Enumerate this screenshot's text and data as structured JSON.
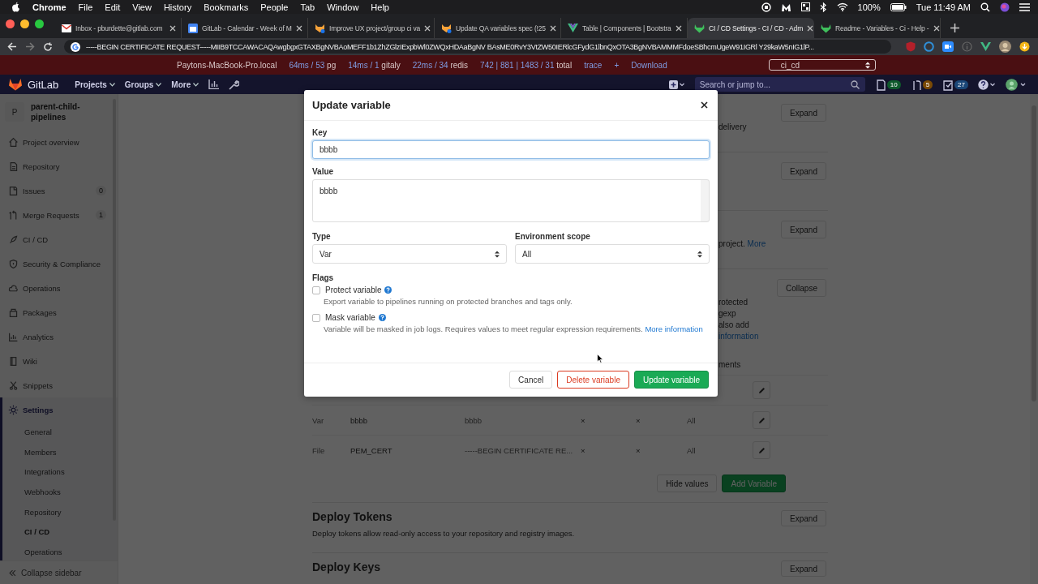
{
  "menu_bar": {
    "app": "Chrome",
    "menus": [
      "File",
      "Edit",
      "View",
      "History",
      "Bookmarks",
      "People",
      "Tab",
      "Window",
      "Help"
    ],
    "battery": "100%",
    "clock": "Tue 11:49 AM"
  },
  "tabs": [
    {
      "title": "Inbox - pburdette@gitlab.com",
      "kind": "mail",
      "selected": false
    },
    {
      "title": "GitLab - Calendar - Week of M",
      "kind": "calendar",
      "selected": false
    },
    {
      "title": "Improve UX project/group ci va",
      "kind": "fox",
      "selected": false
    },
    {
      "title": "Update QA variables spec (!25",
      "kind": "fox",
      "selected": false
    },
    {
      "title": "Table | Components | Bootstra",
      "kind": "vue",
      "selected": false
    },
    {
      "title": "CI / CD Settings - CI / CD - Adm",
      "kind": "tanuki",
      "selected": true
    },
    {
      "title": "Readme - Variables - Ci - Help -",
      "kind": "tanuki",
      "selected": false
    }
  ],
  "address": "-----BEGIN CERTIFICATE REQUEST-----MIIB9TCCAWACAQAwgbgxGTAXBgNVBAoMEFF1b1ZhZGlzIExpbWl0ZWQxHDAaBgNV BAsME0RvY3VtZW50IERlcGFydG1lbnQxOTA3BgNVBAMMMFdoeSBhcmUgeW91IGRl Y29kaW5nIG1lP...",
  "performance_bar": {
    "host": "Paytons-MacBook-Pro.local",
    "stats": [
      {
        "timing": "64ms / 53",
        "store": "pg"
      },
      {
        "timing": "14ms / 1",
        "store": "gitaly"
      },
      {
        "timing": "22ms / 34",
        "store": "redis"
      },
      {
        "timing": "742 | 881 | 1483 / 31",
        "store": "total"
      }
    ],
    "links": [
      "trace",
      "+",
      "Download"
    ],
    "request": "ci_cd"
  },
  "nav": {
    "brand": "GitLab",
    "menus": [
      "Projects",
      "Groups",
      "More"
    ],
    "search": {
      "placeholder": "Search or jump to..."
    },
    "counters": [
      {
        "kind": "issues",
        "count": "10",
        "color": "#0f5a2c"
      },
      {
        "kind": "merge",
        "count": "5",
        "color": "#7a4a05"
      },
      {
        "kind": "todos",
        "count": "27",
        "color": "#1a4778"
      }
    ]
  },
  "sidebar": {
    "project": {
      "avatar": "P",
      "name": "parent-child-pipelines"
    },
    "items": [
      {
        "label": "Project overview",
        "kind": "home",
        "selected": false
      },
      {
        "label": "Repository",
        "kind": "doc",
        "selected": false
      },
      {
        "label": "Issues",
        "kind": "issues",
        "badge": "0",
        "selected": false
      },
      {
        "label": "Merge Requests",
        "kind": "merge",
        "badge": "1",
        "selected": false
      },
      {
        "label": "CI / CD",
        "kind": "rocket",
        "selected": false
      },
      {
        "label": "Security & Compliance",
        "kind": "shield",
        "selected": false
      },
      {
        "label": "Operations",
        "kind": "cloud",
        "selected": false
      },
      {
        "label": "Packages",
        "kind": "package",
        "selected": false
      },
      {
        "label": "Analytics",
        "kind": "chart",
        "selected": false
      },
      {
        "label": "Wiki",
        "kind": "book",
        "selected": false
      },
      {
        "label": "Snippets",
        "kind": "scissors",
        "selected": false
      },
      {
        "label": "Settings",
        "kind": "gear",
        "selected": true,
        "children": [
          {
            "label": "General",
            "selected": false
          },
          {
            "label": "Members",
            "selected": false
          },
          {
            "label": "Integrations",
            "selected": false
          },
          {
            "label": "Webhooks",
            "selected": false
          },
          {
            "label": "Repository",
            "selected": false
          },
          {
            "label": "CI / CD",
            "selected": true
          },
          {
            "label": "Operations",
            "selected": false
          }
        ]
      }
    ],
    "collapse": "Collapse sidebar"
  },
  "sections": [
    {
      "lines": [
        {
          "text": "delivery"
        }
      ],
      "button": "Expand"
    },
    {
      "button": "Expand"
    },
    {
      "lines": [
        {
          "text": "project.",
          "link": "More"
        }
      ],
      "button": "Expand"
    },
    {
      "lines": [
        {
          "text": "rotected"
        },
        {
          "text": "gexp"
        },
        {
          "text": "also add"
        },
        {
          "link": "information"
        }
      ],
      "button": "Collapse",
      "table": {
        "header": "ments",
        "rows": [
          {
            "kind": "covered"
          },
          {
            "kind": "full",
            "type": "Var",
            "key": "bbbb",
            "value": "bbbb",
            "protected": "×",
            "masked": "×",
            "scope": "All"
          },
          {
            "kind": "full",
            "type": "File",
            "key": "PEM_CERT",
            "value": "-----BEGIN CERTIFICATE RE...",
            "protected": "×",
            "masked": "×",
            "scope": "All"
          }
        ],
        "buttons": [
          {
            "label": "Hide values",
            "kind": "default"
          },
          {
            "label": "Add Variable",
            "kind": "primary"
          }
        ]
      }
    }
  ],
  "deploy_sections": [
    {
      "title": "Deploy Tokens",
      "description": "Deploy tokens allow read-only access to your repository and registry images.",
      "button": "Expand"
    },
    {
      "title": "Deploy Keys",
      "button": "Expand"
    }
  ],
  "modal": {
    "title": "Update variable",
    "key": {
      "label": "Key",
      "value": "bbbb"
    },
    "value": {
      "label": "Value",
      "value": "bbbb"
    },
    "type": {
      "label": "Type",
      "value": "Var"
    },
    "scope": {
      "label": "Environment scope",
      "value": "All"
    },
    "flags_label": "Flags",
    "flags": [
      {
        "label": "Protect variable",
        "checked": false,
        "description": "Export variable to pipelines running on protected branches and tags only."
      },
      {
        "label": "Mask variable",
        "checked": false,
        "description": "Variable will be masked in job logs. Requires values to meet regular expression requirements.",
        "link": "More information"
      }
    ],
    "buttons": [
      {
        "label": "Cancel",
        "kind": "default"
      },
      {
        "label": "Delete variable",
        "kind": "danger"
      },
      {
        "label": "Update variable",
        "kind": "primary"
      }
    ]
  }
}
